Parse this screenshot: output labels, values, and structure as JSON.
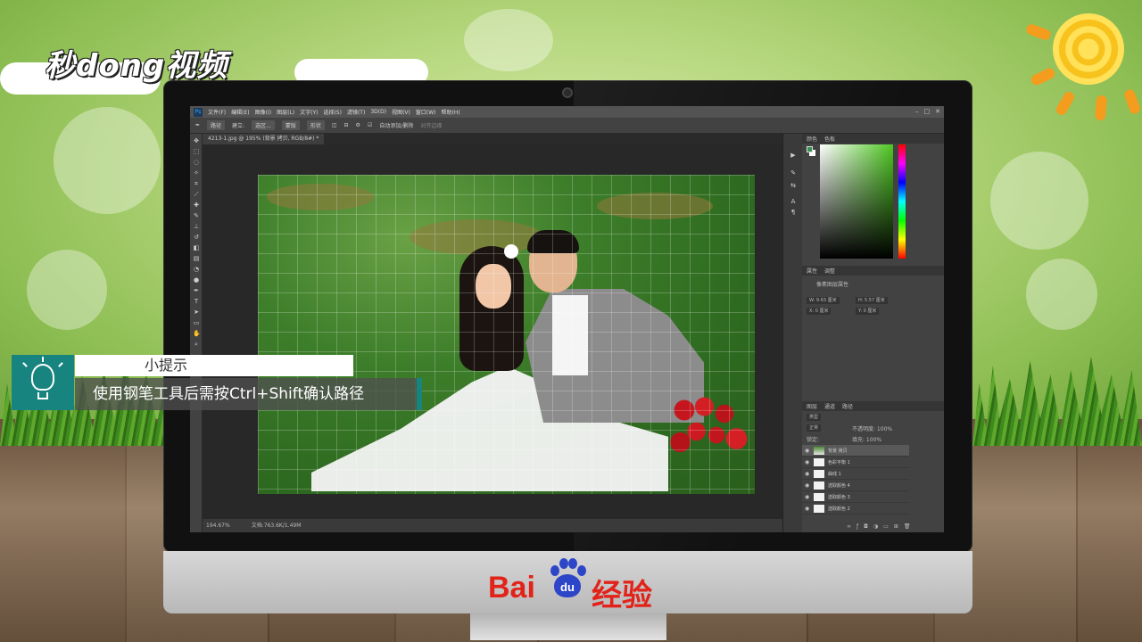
{
  "brand": {
    "logo_text": "秒dong视频"
  },
  "photoshop": {
    "logo": "Ps",
    "menu": [
      "文件(F)",
      "编辑(E)",
      "图像(I)",
      "图层(L)",
      "文字(Y)",
      "选择(S)",
      "滤镜(T)",
      "3D(D)",
      "视图(V)",
      "窗口(W)",
      "帮助(H)"
    ],
    "window_controls": [
      "–",
      "□",
      "✕"
    ],
    "options": {
      "mode": "路径",
      "make_label": "建立:",
      "selection": "选区...",
      "mask": "蒙版",
      "shape": "形状",
      "auto_add": "自动添加/删除",
      "align_edges": "对齐边缘"
    },
    "doc_tab": "4213-1.jpg @ 195% (背景 拷贝, RGB/8#) *",
    "status": {
      "zoom": "194.67%",
      "doc": "文档:763.6K/1.49M"
    },
    "panels": {
      "color_tabs": [
        "颜色",
        "色板"
      ],
      "props_tabs": [
        "属性",
        "调整"
      ],
      "props_title": "像素图层属性",
      "props_w": "W: 9.63 厘米",
      "props_h": "H: 5.57 厘米",
      "props_x": "X: 0 厘米",
      "props_y": "Y: 0 厘米",
      "layers_tabs": [
        "图层",
        "通道",
        "路径"
      ],
      "layers_kind": "类型",
      "layers_blend": "正常",
      "layers_opacity": "不透明度: 100%",
      "layers_lock": "锁定:",
      "layers_fill": "填充: 100%",
      "layers": [
        {
          "name": "背景 拷贝",
          "active": true
        },
        {
          "name": "色彩平衡 1",
          "active": false
        },
        {
          "name": "曲线 1",
          "active": false
        },
        {
          "name": "选取颜色 4",
          "active": false
        },
        {
          "name": "选取颜色 3",
          "active": false
        },
        {
          "name": "选取颜色 2",
          "active": false
        }
      ]
    }
  },
  "tip": {
    "title": "小提示",
    "body": "使用钢笔工具后需按Ctrl+Shift确认路径"
  },
  "footer": {
    "baidu_left": "Bai",
    "baidu_paw": "du",
    "baidu_right": "经验"
  },
  "colors": {
    "accent": "#17847f",
    "baidu_red": "#e2231a",
    "baidu_blue": "#2d46c8"
  }
}
